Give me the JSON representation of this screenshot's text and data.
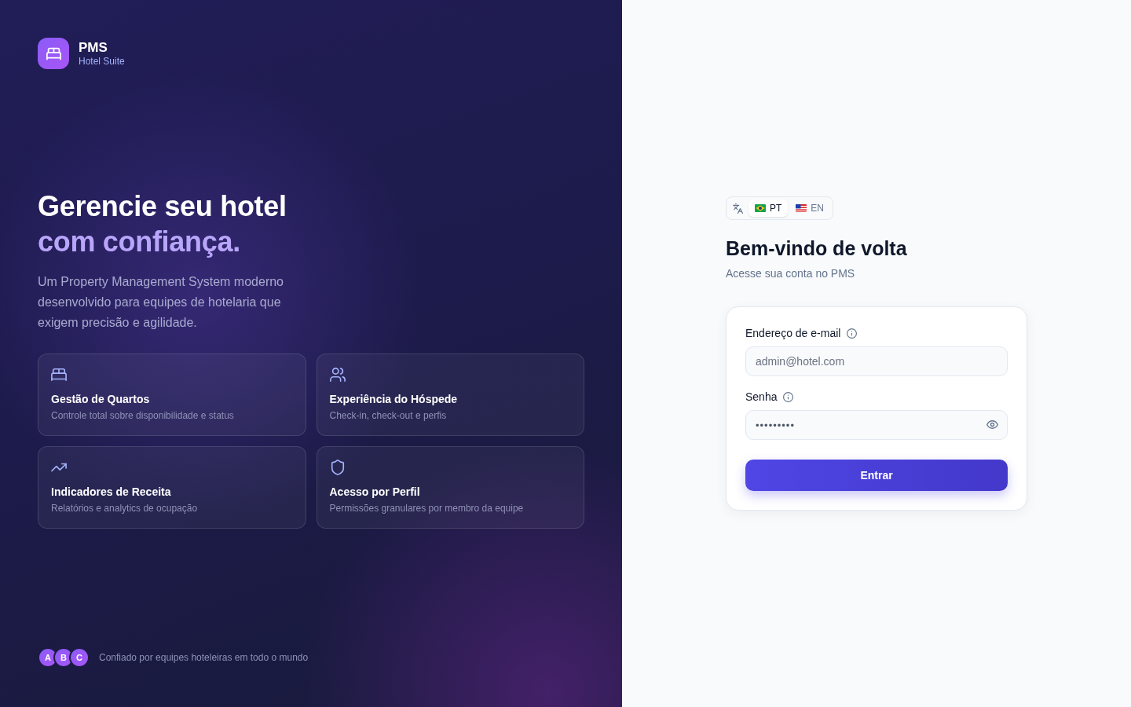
{
  "brand": {
    "name": "PMS",
    "tagline": "Hotel Suite"
  },
  "hero": {
    "title": "Gerencie seu hotel",
    "title_highlight": "com confiança.",
    "description": "Um Property Management System moderno desenvolvido para equipes de hotelaria que exigem precisão e agilidade."
  },
  "features": [
    {
      "title": "Gestão de Quartos",
      "description": "Controle total sobre disponibilidade e status"
    },
    {
      "title": "Experiência do Hóspede",
      "description": "Check-in, check-out e perfis"
    },
    {
      "title": "Indicadores de Receita",
      "description": "Relatórios e analytics de ocupação"
    },
    {
      "title": "Acesso por Perfil",
      "description": "Permissões granulares por membro da equipe"
    }
  ],
  "trust": {
    "avatars": [
      "A",
      "B",
      "C"
    ],
    "text": "Confiado por equipes hoteleiras em todo o mundo"
  },
  "language_switcher": {
    "options": [
      {
        "code": "PT",
        "selected": true
      },
      {
        "code": "EN",
        "selected": false
      }
    ]
  },
  "login": {
    "title": "Bem-vindo de volta",
    "subtitle": "Acesse sua conta no PMS",
    "fields": [
      {
        "kind": "email",
        "label": "Endereço de e-mail",
        "placeholder": "admin@hotel.com"
      },
      {
        "kind": "password",
        "label": "Senha",
        "placeholder": "•••••••••"
      }
    ],
    "submit": "Entrar"
  }
}
